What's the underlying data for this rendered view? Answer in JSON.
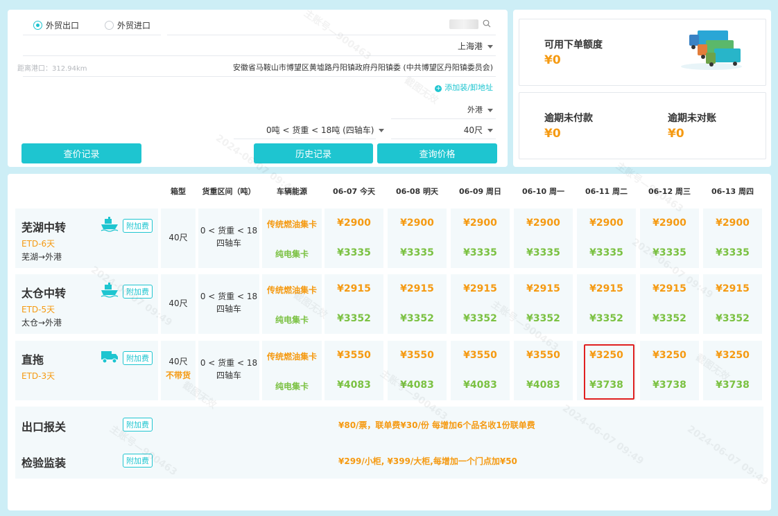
{
  "form": {
    "radio_export": "外贸出口",
    "radio_import": "外贸进口",
    "port": "上海港",
    "distance": "距离港口：312.94km",
    "address": "安徽省马鞍山市博望区黄墟路丹阳镇政府丹阳镇委 (中共博望区丹阳镇委员会)",
    "add_address": "添加装/卸地址",
    "harbor": "外港",
    "cargo_weight": "0吨 < 货重 < 18吨 (四轴车)",
    "container": "40尺",
    "btn_price_records": "查价记录",
    "btn_history": "历史记录",
    "btn_query": "查询价格"
  },
  "summary": {
    "credit_label": "可用下单额度",
    "credit_value": "¥0",
    "overdue_unpaid_label": "逾期未付款",
    "overdue_unpaid_value": "¥0",
    "overdue_unreconciled_label": "逾期未对账",
    "overdue_unreconciled_value": "¥0"
  },
  "table": {
    "headers": {
      "box": "箱型",
      "weight": "货重区间（吨）",
      "energy": "车辆能源",
      "dates": [
        "06-07 今天",
        "06-08 明天",
        "06-09 周日",
        "06-10 周一",
        "06-11 周二",
        "06-12 周三",
        "06-13 周四"
      ]
    },
    "fee_badge": "附加费",
    "energy_fuel": "传统燃油集卡",
    "energy_electric": "纯电集卡",
    "rows": [
      {
        "name": "芜湖中转",
        "etd": "ETD-6天",
        "route": "芜湖→外港",
        "box": "40尺",
        "weight_1": "0 < 货重 < 18",
        "weight_2": "四轴车",
        "fuel": [
          "¥2900",
          "¥2900",
          "¥2900",
          "¥2900",
          "¥2900",
          "¥2900",
          "¥2900"
        ],
        "electric": [
          "¥3335",
          "¥3335",
          "¥3335",
          "¥3335",
          "¥3335",
          "¥3335",
          "¥3335"
        ]
      },
      {
        "name": "太仓中转",
        "etd": "ETD-5天",
        "route": "太仓→外港",
        "box": "40尺",
        "weight_1": "0 < 货重 < 18",
        "weight_2": "四轴车",
        "fuel": [
          "¥2915",
          "¥2915",
          "¥2915",
          "¥2915",
          "¥2915",
          "¥2915",
          "¥2915"
        ],
        "electric": [
          "¥3352",
          "¥3352",
          "¥3352",
          "¥3352",
          "¥3352",
          "¥3352",
          "¥3352"
        ]
      },
      {
        "name": "直拖",
        "etd": "ETD-3天",
        "no_cargo": "不带货",
        "box": "40尺",
        "weight_1": "0 < 货重 < 18",
        "weight_2": "四轴车",
        "fuel": [
          "¥3550",
          "¥3550",
          "¥3550",
          "¥3550",
          "¥3250",
          "¥3250",
          "¥3250"
        ],
        "electric": [
          "¥4083",
          "¥4083",
          "¥4083",
          "¥4083",
          "¥3738",
          "¥3738",
          "¥3738"
        ]
      }
    ],
    "extra": [
      {
        "name": "出口报关",
        "text": "¥80/票，联单费¥30/份   每增加6个品名收1份联单费"
      },
      {
        "name": "检验监装",
        "text": "¥299/小柜, ¥399/大柜,每增加一个门点加¥50"
      }
    ]
  },
  "watermark": {
    "line1": "主账号—900463",
    "line2": "2024-06-07 09:49",
    "line3": "截图无效"
  },
  "colors": {
    "accent": "#1ec5d0",
    "price_orange": "#f59a12",
    "price_green": "#7bc142",
    "highlight": "#e02020"
  }
}
